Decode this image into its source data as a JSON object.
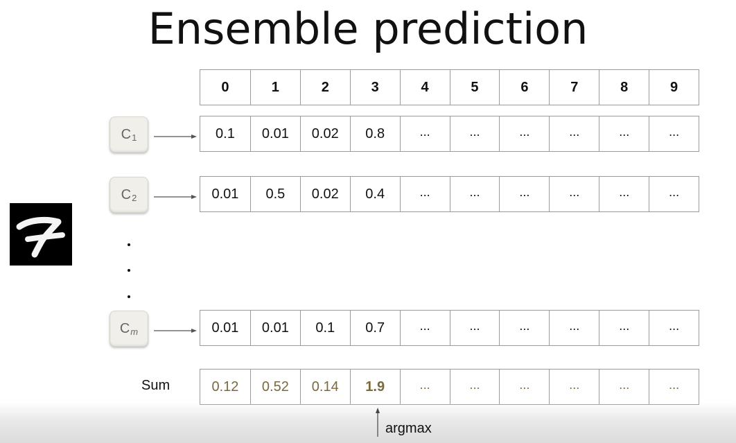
{
  "title": "Ensemble prediction",
  "classes": [
    "0",
    "1",
    "2",
    "3",
    "4",
    "5",
    "6",
    "7",
    "8",
    "9"
  ],
  "classifiers": [
    {
      "label": "C",
      "subscript": "1",
      "values": [
        "0.1",
        "0.01",
        "0.02",
        "0.8",
        "...",
        "...",
        "...",
        "...",
        "...",
        "..."
      ]
    },
    {
      "label": "C",
      "subscript": "2",
      "values": [
        "0.01",
        "0.5",
        "0.02",
        "0.4",
        "...",
        "...",
        "...",
        "...",
        "...",
        "..."
      ]
    },
    {
      "label": "C",
      "subscript": "m",
      "values": [
        "0.01",
        "0.01",
        "0.1",
        "0.7",
        "...",
        "...",
        "...",
        "...",
        "...",
        "..."
      ]
    }
  ],
  "sum": {
    "label": "Sum",
    "values": [
      "0.12",
      "0.52",
      "0.14",
      "1.9",
      "...",
      "...",
      "...",
      "...",
      "...",
      "..."
    ],
    "highlight_index": 3
  },
  "argmax_label": "argmax",
  "colors": {
    "sum_text": "#7a6a3a",
    "grid": "#9a9a9a"
  }
}
